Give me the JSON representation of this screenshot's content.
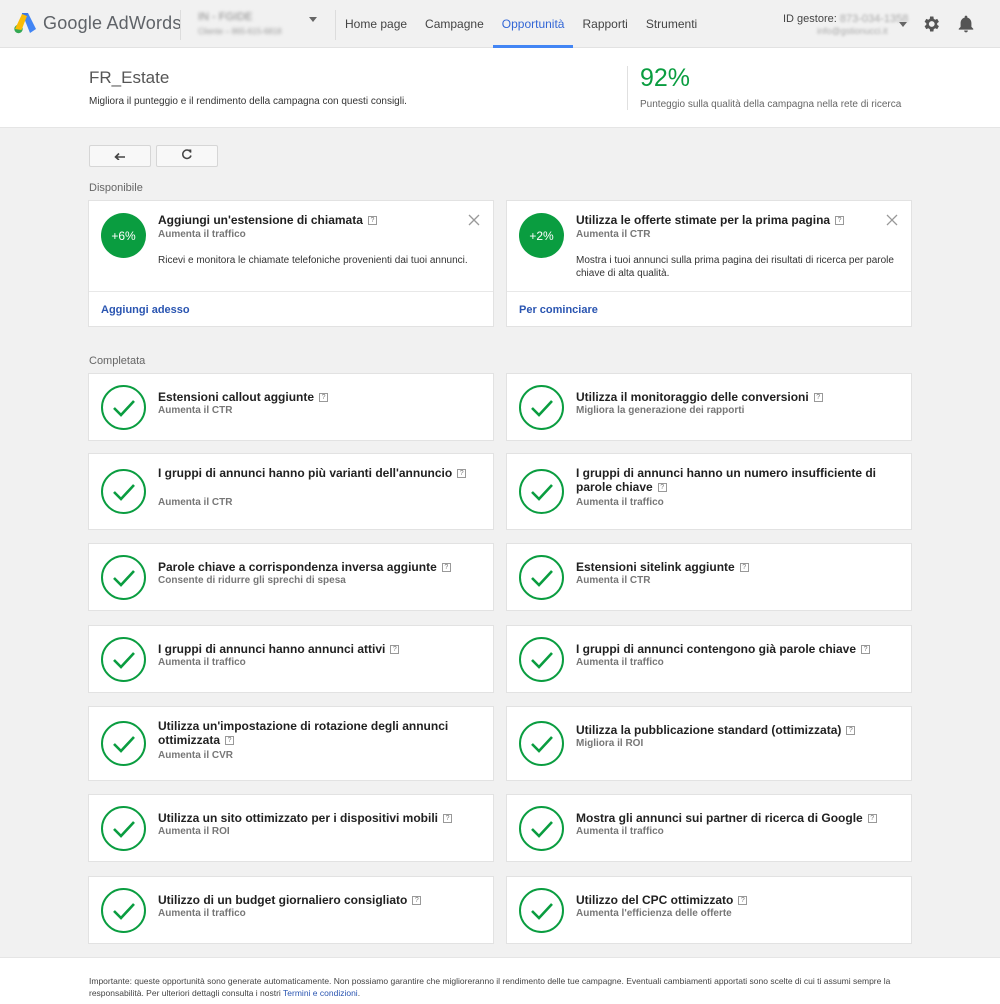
{
  "topbar": {
    "logo_text": "Google AdWords",
    "account_name": "IN - FGIDE",
    "account_detail": "Cliente – 865-615-6818",
    "nav": [
      {
        "label": "Home page",
        "active": false
      },
      {
        "label": "Campagne",
        "active": false
      },
      {
        "label": "Opportunità",
        "active": true
      },
      {
        "label": "Rapporti",
        "active": false
      },
      {
        "label": "Strumenti",
        "active": false
      }
    ],
    "gestore_label": "ID gestore:",
    "gestore_id": "873-034-1358",
    "gestore_email": "info@gstionucci.it",
    "icons": [
      "gear-icon",
      "bell-icon"
    ]
  },
  "header": {
    "campaign_name": "FR_Estate",
    "campaign_subtitle": "Migliora il punteggio e il rendimento della campagna con questi consigli.",
    "score": "92%",
    "score_label": "Punteggio sulla qualità della campagna nella rete di ricerca"
  },
  "toolbar": {
    "back_icon": "back-arrow-icon",
    "refresh_icon": "refresh-icon"
  },
  "available": {
    "label": "Disponibile",
    "cards": [
      {
        "badge": "+6%",
        "title": "Aggiungi un'estensione di chiamata",
        "subtitle": "Aumenta il traffico",
        "description": "Ricevi e monitora le chiamate telefoniche provenienti dai tuoi annunci.",
        "action": "Aggiungi adesso"
      },
      {
        "badge": "+2%",
        "title": "Utilizza le offerte stimate per la prima pagina",
        "subtitle": "Aumenta il CTR",
        "description": "Mostra i tuoi annunci sulla prima pagina dei risultati di ricerca per parole chiave di alta qualità.",
        "action": "Per cominciare"
      }
    ]
  },
  "completed": {
    "label": "Completata",
    "cards": [
      {
        "title": "Estensioni callout aggiunte",
        "subtitle": "Aumenta il CTR"
      },
      {
        "title": "Utilizza il monitoraggio delle conversioni",
        "subtitle": "Migliora la generazione dei rapporti"
      },
      {
        "title": "I gruppi di annunci hanno più varianti dell'annuncio",
        "subtitle": "Aumenta il CTR"
      },
      {
        "title": "I gruppi di annunci hanno un numero insufficiente di parole chiave",
        "subtitle": "Aumenta il traffico"
      },
      {
        "title": "Parole chiave a corrispondenza inversa aggiunte",
        "subtitle": "Consente di ridurre gli sprechi di spesa"
      },
      {
        "title": "Estensioni sitelink aggiunte",
        "subtitle": "Aumenta il CTR"
      },
      {
        "title": "I gruppi di annunci hanno annunci attivi",
        "subtitle": "Aumenta il traffico"
      },
      {
        "title": "I gruppi di annunci contengono già parole chiave",
        "subtitle": "Aumenta il traffico"
      },
      {
        "title": "Utilizza un'impostazione di rotazione degli annunci ottimizzata",
        "subtitle": "Aumenta il CVR"
      },
      {
        "title": "Utilizza la pubblicazione standard (ottimizzata)",
        "subtitle": "Migliora il ROI"
      },
      {
        "title": "Utilizza un sito ottimizzato per i dispositivi mobili",
        "subtitle": "Aumenta il ROI"
      },
      {
        "title": "Mostra gli annunci sui partner di ricerca di Google",
        "subtitle": "Aumenta il traffico"
      },
      {
        "title": "Utilizzo di un budget giornaliero consigliato",
        "subtitle": "Aumenta il traffico"
      },
      {
        "title": "Utilizzo del CPC ottimizzato",
        "subtitle": "Aumenta l'efficienza delle offerte"
      }
    ]
  },
  "footer": {
    "text": "Importante: queste opportunità sono generate automaticamente. Non possiamo garantire che miglioreranno il rendimento delle tue campagne. Eventuali cambiamenti apportati sono scelte di cui ti assumi sempre la responsabilità. Per ulteriori dettagli consulta i nostri",
    "link": "Termini e condizioni",
    "end": "."
  },
  "colors": {
    "accent_blue": "#4285f4",
    "link_blue": "#2a55b1",
    "success_green": "#0a9d40"
  }
}
